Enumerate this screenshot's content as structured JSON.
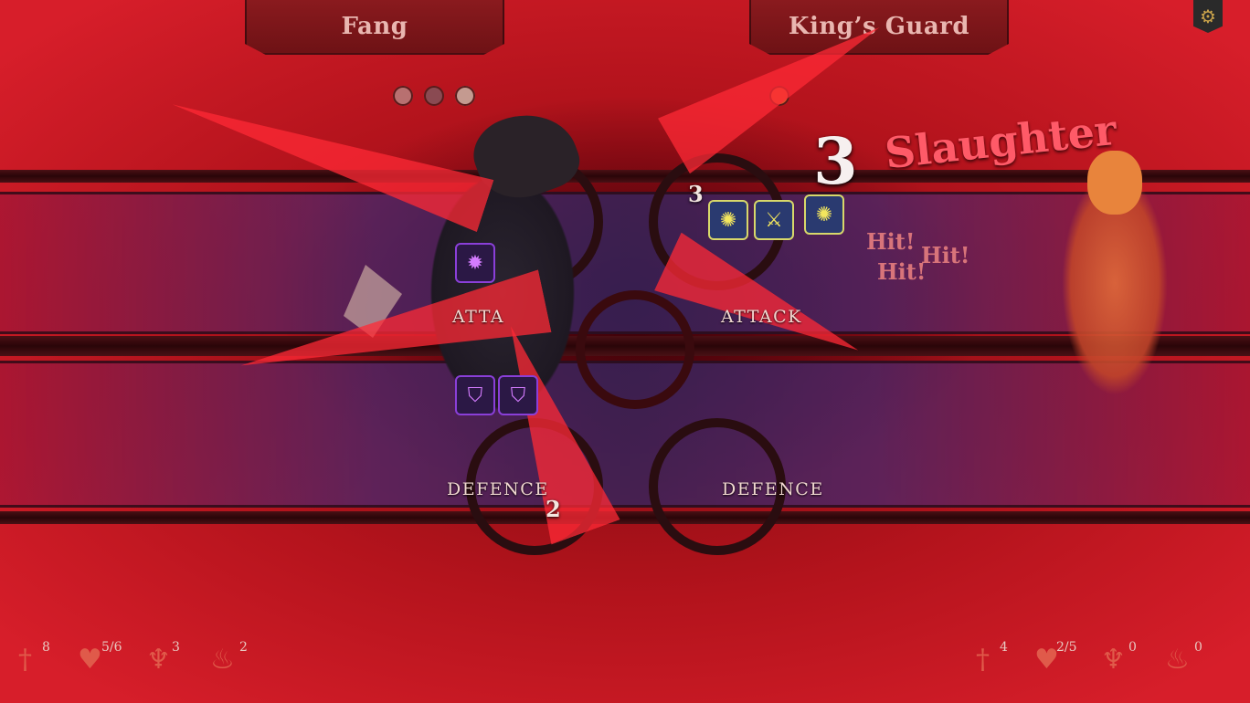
{
  "player": {
    "name": "Fang",
    "status_icons": [
      "rune-icon",
      "acorn-icon",
      "stone-icon"
    ],
    "attack_dice": [
      "burst-die-icon"
    ],
    "defence_dice": [
      "shield-die-icon",
      "shield-die-icon"
    ],
    "attack_label": "ATTA",
    "defence_label": "DEFENCE",
    "defence_value": "2",
    "stats": [
      {
        "icon": "sword-icon",
        "value": "8"
      },
      {
        "icon": "heart-icon",
        "value": "5/6"
      },
      {
        "icon": "trophy-icon",
        "value": "3"
      },
      {
        "icon": "flame-icon",
        "value": "2"
      }
    ]
  },
  "enemy": {
    "name": "King’s Guard",
    "status_icons": [
      "sun-burst-icon"
    ],
    "attack_value": "3",
    "attack_dice": [
      "sun-die-icon",
      "crossed-swords-die-icon",
      "sun-die-icon"
    ],
    "attack_label": "ATTACK",
    "defence_label": "DEFENCE",
    "stats": [
      {
        "icon": "sword-icon",
        "value": "4"
      },
      {
        "icon": "heart-icon",
        "value": "2/5"
      },
      {
        "icon": "trophy-icon",
        "value": "0"
      },
      {
        "icon": "flame-icon",
        "value": "0"
      }
    ]
  },
  "combo": {
    "count": "3",
    "label": "Slaughter"
  },
  "hits": [
    "Hit!",
    "Hit!",
    "Hit!"
  ],
  "settings_icon": "gear-icon",
  "colors": {
    "blood": "#ff2a36",
    "nameplate": "#8a1a1e",
    "lane": "#3c2a6a"
  }
}
